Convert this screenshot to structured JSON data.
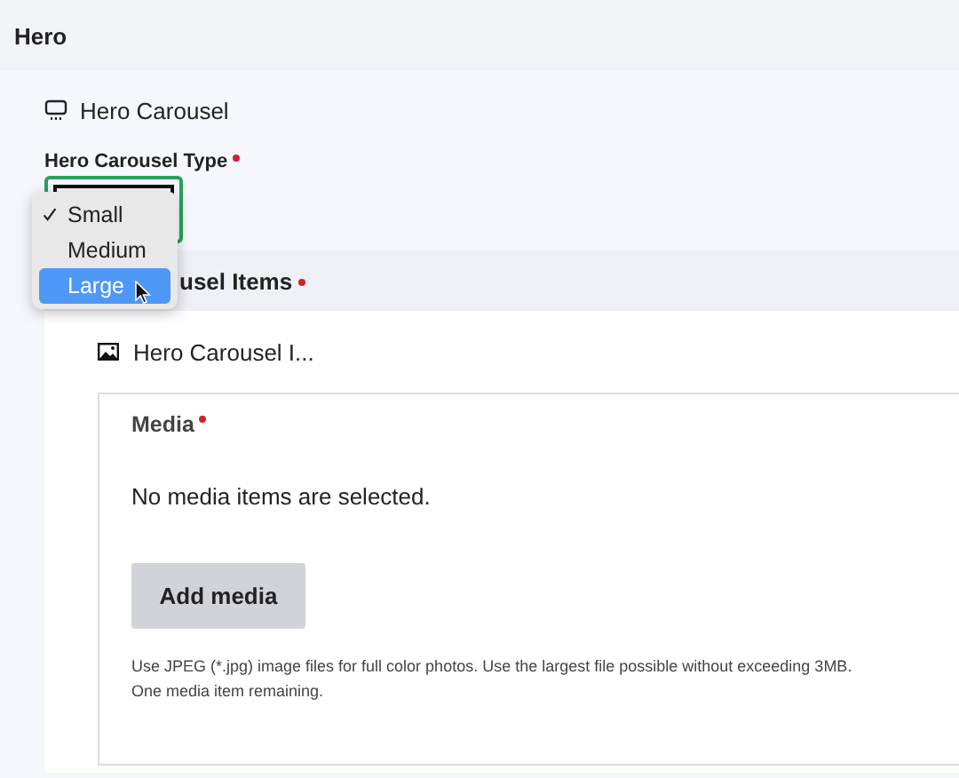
{
  "section": {
    "title": "Hero"
  },
  "carousel": {
    "title": "Hero Carousel"
  },
  "type_field": {
    "label": "Hero Carousel Type",
    "required": true
  },
  "dropdown": {
    "options": [
      {
        "label": "Small",
        "checked": true,
        "highlighted": false
      },
      {
        "label": "Medium",
        "checked": false,
        "highlighted": false
      },
      {
        "label": "Large",
        "checked": false,
        "highlighted": true
      }
    ]
  },
  "items_section": {
    "title": "usel Items",
    "required": true
  },
  "item": {
    "title": "Hero Carousel I..."
  },
  "media": {
    "label": "Media",
    "required": true,
    "empty_text": "No media items are selected.",
    "button": "Add media",
    "help": [
      "Use JPEG (*.jpg) image files for full color photos. Use the largest file possible without exceeding 3MB.",
      "One media item remaining."
    ]
  }
}
